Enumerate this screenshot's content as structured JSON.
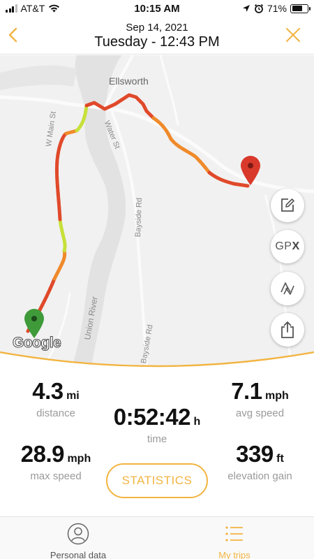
{
  "status_bar": {
    "carrier": "AT&T",
    "time": "10:15 AM",
    "battery": "71%",
    "battery_level": 0.71
  },
  "header": {
    "date": "Sep 14, 2021",
    "title": "Tuesday - 12:43 PM",
    "back_icon": "chevron-left-icon",
    "close_icon": "close-icon"
  },
  "map": {
    "town": "Ellsworth",
    "labels": {
      "main_st": "W Main St",
      "water_st": "Water St",
      "bayside_rd_1": "Bayside Rd",
      "bayside_rd_2": "Bayside Rd",
      "river": "Union River"
    },
    "attribution": "Google",
    "buttons": {
      "edit_icon": "edit-icon",
      "gpx_label": "GP",
      "gpx_x": "X",
      "route_icon": "route-icon",
      "share_icon": "share-icon"
    },
    "colors": {
      "start_marker": "#3f9a3a",
      "end_marker": "#d9392b",
      "track_hot": "#e0492a",
      "track_warm": "#f08a2b",
      "track_cool": "#c7e03a"
    }
  },
  "stats": {
    "distance": {
      "value": "4.3",
      "unit": "mi",
      "label": "distance"
    },
    "avg_speed": {
      "value": "7.1",
      "unit": "mph",
      "label": "avg speed"
    },
    "time": {
      "value": "0:52:42",
      "unit": "h",
      "label": "time"
    },
    "max_speed": {
      "value": "28.9",
      "unit": "mph",
      "label": "max speed"
    },
    "elevation_gain": {
      "value": "339",
      "unit": "ft",
      "label": "elevation gain"
    },
    "statistics_button": "STATISTICS",
    "accent_color": "#f2b441"
  },
  "bottom_nav": {
    "personal_data": "Personal data",
    "my_trips": "My trips",
    "active_color": "#f2b441"
  }
}
